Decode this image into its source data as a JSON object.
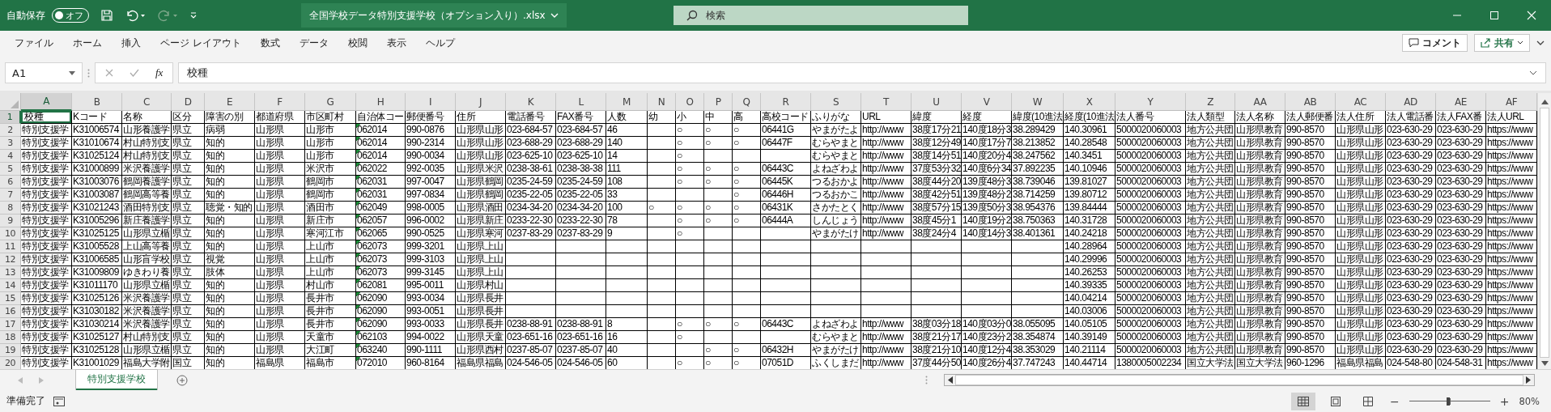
{
  "title_bar": {
    "autosave_label": "自動保存",
    "autosave": {
      "on": false,
      "label": "オフ"
    },
    "undo": {
      "disabled": false
    },
    "redo": {
      "disabled": true
    },
    "title": "全国学校データ特別支援学校（オプション入り）.xlsx",
    "search": {
      "placeholder": "検索"
    }
  },
  "ribbon_tabs": [
    "ファイル",
    "ホーム",
    "挿入",
    "ページ レイアウト",
    "数式",
    "データ",
    "校閲",
    "表示",
    "ヘルプ"
  ],
  "ribbon_buttons": {
    "comment": "コメント",
    "share": "共有"
  },
  "formula_bar": {
    "name_box": "A1",
    "fx": "fx",
    "value": "校種"
  },
  "columns": [
    {
      "label": "A",
      "selected": true
    },
    {
      "label": "B",
      "selected": false
    },
    {
      "label": "C",
      "selected": false
    },
    {
      "label": "D",
      "selected": false
    },
    {
      "label": "E",
      "selected": false
    },
    {
      "label": "F",
      "selected": false
    },
    {
      "label": "G",
      "selected": false
    },
    {
      "label": "H",
      "selected": false
    },
    {
      "label": "I",
      "selected": false
    },
    {
      "label": "J",
      "selected": false
    },
    {
      "label": "K",
      "selected": false
    },
    {
      "label": "L",
      "selected": false
    },
    {
      "label": "M",
      "selected": false
    },
    {
      "label": "N",
      "selected": false
    },
    {
      "label": "O",
      "selected": false
    },
    {
      "label": "P",
      "selected": false
    },
    {
      "label": "Q",
      "selected": false
    },
    {
      "label": "R",
      "selected": false
    },
    {
      "label": "S",
      "selected": false
    },
    {
      "label": "T",
      "selected": false
    },
    {
      "label": "U",
      "selected": false
    },
    {
      "label": "V",
      "selected": false
    },
    {
      "label": "W",
      "selected": false
    },
    {
      "label": "X",
      "selected": false
    },
    {
      "label": "Y",
      "selected": false
    },
    {
      "label": "Z",
      "selected": false
    },
    {
      "label": "AA",
      "selected": false
    },
    {
      "label": "AB",
      "selected": false
    },
    {
      "label": "AC",
      "selected": false
    },
    {
      "label": "AD",
      "selected": false
    },
    {
      "label": "AE",
      "selected": false
    },
    {
      "label": "AF",
      "selected": false
    }
  ],
  "rows": [
    {
      "number": "1",
      "selected": true,
      "cells": [
        "校種",
        "Kコード",
        "名称",
        "区分",
        "障害の別",
        "都道府県",
        "市区町村",
        "自治体コー",
        "郵便番号",
        "住所",
        "電話番号",
        "FAX番号",
        "人数",
        "幼",
        "小",
        "中",
        "高",
        "高校コード",
        "ふりがな",
        "URL",
        "緯度",
        "経度",
        "緯度(10進法",
        "経度(10進法",
        "法人番号",
        "法人類型",
        "法人名称",
        "法人郵便番",
        "法人住所",
        "法人電話番",
        "法人FAX番",
        "法人URL"
      ]
    },
    {
      "number": "2",
      "selected": false,
      "cells": [
        "特別支援学",
        "K31006574",
        "山形養護学",
        "県立",
        "病弱",
        "山形県",
        "山形市",
        "062014",
        "990-0876",
        "山形県山形",
        "023-684-57",
        "023-684-57",
        "46",
        null,
        "○",
        "○",
        "○",
        "06441G",
        "やまがたよ",
        "http://www",
        "38度17分21",
        "140度18分3",
        "38.289429",
        "140.30961",
        "5000020060003",
        "地方公共団",
        "山形県教育",
        "990-8570",
        "山形県山形",
        "023-630-29",
        "023-630-29",
        "https://www"
      ]
    },
    {
      "number": "3",
      "selected": false,
      "cells": [
        "特別支援学",
        "K31010674",
        "村山特別支",
        "県立",
        "知的",
        "山形県",
        "山形市",
        "062014",
        "990-2314",
        "山形県山形",
        "023-688-29",
        "023-688-29",
        "140",
        null,
        "○",
        "○",
        "○",
        "06447F",
        "むらやまと",
        "http://www",
        "38度12分49",
        "140度17分7",
        "38.213852",
        "140.28548",
        "5000020060003",
        "地方公共団",
        "山形県教育",
        "990-8570",
        "山形県山形",
        "023-630-29",
        "023-630-29",
        "https://www"
      ]
    },
    {
      "number": "4",
      "selected": false,
      "cells": [
        "特別支援学",
        "K31025124",
        "村山特別支",
        "県立",
        "知的",
        "山形県",
        "山形市",
        "062014",
        "990-0034",
        "山形県山形",
        "023-625-10",
        "023-625-10",
        "14",
        null,
        "○",
        null,
        null,
        null,
        "むらやまと",
        "http://www",
        "38度14分51",
        "140度20分4",
        "38.247562",
        "140.3451",
        "5000020060003",
        "地方公共団",
        "山形県教育",
        "990-8570",
        "山形県山形",
        "023-630-29",
        "023-630-29",
        "https://www"
      ]
    },
    {
      "number": "5",
      "selected": false,
      "cells": [
        "特別支援学",
        "K31000899",
        "米沢養護学",
        "県立",
        "知的",
        "山形県",
        "米沢市",
        "062022",
        "992-0035",
        "山形県米沢",
        "0238-38-61",
        "0238-38-38",
        "111",
        null,
        "○",
        "○",
        "○",
        "06443C",
        "よねざわよ",
        "http://www",
        "37度53分32",
        "140度6分34",
        "37.892235",
        "140.10946",
        "5000020060003",
        "地方公共団",
        "山形県教育",
        "990-8570",
        "山形県山形",
        "023-630-29",
        "023-630-29",
        "https://www"
      ]
    },
    {
      "number": "6",
      "selected": false,
      "cells": [
        "特別支援学",
        "K31003076",
        "鶴岡養護学",
        "県立",
        "知的",
        "山形県",
        "鶴岡市",
        "062031",
        "997-0047",
        "山形県鶴岡",
        "0235-24-59",
        "0235-24-59",
        "108",
        null,
        "○",
        "○",
        "○",
        "06445K",
        "つるおかよ",
        "http://www",
        "38度44分20",
        "139度48分3",
        "38.739046",
        "139.81027",
        "5000020060003",
        "地方公共団",
        "山形県教育",
        "990-8570",
        "山形県山形",
        "023-630-29",
        "023-630-29",
        "https://www"
      ]
    },
    {
      "number": "7",
      "selected": false,
      "cells": [
        "特別支援学",
        "K31003087",
        "鶴岡高等養",
        "県立",
        "知的",
        "山形県",
        "鶴岡市",
        "062031",
        "997-0834",
        "山形県鶴岡",
        "0235-22-05",
        "0235-22-05",
        "33",
        null,
        null,
        null,
        "○",
        "06446H",
        "つるおかこ",
        "http://www",
        "38度42分51",
        "139度48分2",
        "38.714259",
        "139.80712",
        "5000020060003",
        "地方公共団",
        "山形県教育",
        "990-8570",
        "山形県山形",
        "023-630-29",
        "023-630-29",
        "https://www"
      ]
    },
    {
      "number": "8",
      "selected": false,
      "cells": [
        "特別支援学",
        "K31021243",
        "酒田特別支",
        "県立",
        "聴覚・知的",
        "山形県",
        "酒田市",
        "062049",
        "998-0005",
        "山形県酒田",
        "0234-34-20",
        "0234-34-20",
        "100",
        "○",
        "○",
        "○",
        "○",
        "06431K",
        "さかたとく",
        "http://www",
        "38度57分15",
        "139度50分3",
        "38.954376",
        "139.84444",
        "5000020060003",
        "地方公共団",
        "山形県教育",
        "990-8570",
        "山形県山形",
        "023-630-29",
        "023-630-29",
        "https://www"
      ]
    },
    {
      "number": "9",
      "selected": false,
      "cells": [
        "特別支援学",
        "K31005296",
        "新庄養護学",
        "県立",
        "知的",
        "山形県",
        "新庄市",
        "062057",
        "996-0002",
        "山形県新庄",
        "0233-22-30",
        "0233-22-30",
        "78",
        null,
        "○",
        "○",
        "○",
        "06444A",
        "しんじょう",
        "http://www",
        "38度45分1",
        "140度19分2",
        "38.750363",
        "140.31728",
        "5000020060003",
        "地方公共団",
        "山形県教育",
        "990-8570",
        "山形県山形",
        "023-630-29",
        "023-630-29",
        "https://www"
      ]
    },
    {
      "number": "10",
      "selected": false,
      "cells": [
        "特別支援学",
        "K31025125",
        "山形県立楯",
        "県立",
        "知的",
        "山形県",
        "寒河江市",
        "062065",
        "990-0525",
        "山形県寒河",
        "0237-83-29",
        "0237-83-29",
        "9",
        null,
        "○",
        null,
        null,
        null,
        "やまがたけ",
        "http://www",
        "38度24分4",
        "140度14分3",
        "38.401361",
        "140.24218",
        "5000020060003",
        "地方公共団",
        "山形県教育",
        "990-8570",
        "山形県山形",
        "023-630-29",
        "023-630-29",
        "https://www"
      ]
    },
    {
      "number": "11",
      "selected": false,
      "cells": [
        "特別支援学",
        "K31005528",
        "上山高等養",
        "県立",
        "知的",
        "山形県",
        "上山市",
        "062073",
        "999-3201",
        "山形県上山",
        null,
        null,
        null,
        null,
        null,
        null,
        null,
        null,
        null,
        null,
        null,
        null,
        null,
        "140.28964",
        "5000020060003",
        "地方公共団",
        "山形県教育",
        "990-8570",
        "山形県山形",
        "023-630-29",
        "023-630-29",
        "https://www"
      ]
    },
    {
      "number": "12",
      "selected": false,
      "cells": [
        "特別支援学",
        "K31006585",
        "山形盲学校",
        "県立",
        "視覚",
        "山形県",
        "上山市",
        "062073",
        "999-3103",
        "山形県上山",
        null,
        null,
        null,
        null,
        null,
        null,
        null,
        null,
        null,
        null,
        null,
        null,
        null,
        "140.29996",
        "5000020060003",
        "地方公共団",
        "山形県教育",
        "990-8570",
        "山形県山形",
        "023-630-29",
        "023-630-29",
        "https://www"
      ]
    },
    {
      "number": "13",
      "selected": false,
      "cells": [
        "特別支援学",
        "K31009809",
        "ゆきわり養",
        "県立",
        "肢体",
        "山形県",
        "上山市",
        "062073",
        "999-3145",
        "山形県上山",
        null,
        null,
        null,
        null,
        null,
        null,
        null,
        null,
        null,
        null,
        null,
        null,
        null,
        "140.26253",
        "5000020060003",
        "地方公共団",
        "山形県教育",
        "990-8570",
        "山形県山形",
        "023-630-29",
        "023-630-29",
        "https://www"
      ]
    },
    {
      "number": "14",
      "selected": false,
      "cells": [
        "特別支援学",
        "K31011170",
        "山形県立楯",
        "県立",
        "知的",
        "山形県",
        "村山市",
        "062081",
        "995-0011",
        "山形県村山",
        null,
        null,
        null,
        null,
        null,
        null,
        null,
        null,
        null,
        null,
        null,
        null,
        null,
        "140.39335",
        "5000020060003",
        "地方公共団",
        "山形県教育",
        "990-8570",
        "山形県山形",
        "023-630-29",
        "023-630-29",
        "https://www"
      ]
    },
    {
      "number": "15",
      "selected": false,
      "cells": [
        "特別支援学",
        "K31025126",
        "米沢養護学",
        "県立",
        "知的",
        "山形県",
        "長井市",
        "062090",
        "993-0034",
        "山形県長井",
        null,
        null,
        null,
        null,
        null,
        null,
        null,
        null,
        null,
        null,
        null,
        null,
        null,
        "140.04214",
        "5000020060003",
        "地方公共団",
        "山形県教育",
        "990-8570",
        "山形県山形",
        "023-630-29",
        "023-630-29",
        "https://www"
      ]
    },
    {
      "number": "16",
      "selected": false,
      "cells": [
        "特別支援学",
        "K31030182",
        "米沢養護学",
        "県立",
        "知的",
        "山形県",
        "長井市",
        "062090",
        "993-0051",
        "山形県長井",
        null,
        null,
        null,
        null,
        null,
        null,
        null,
        null,
        null,
        null,
        null,
        null,
        null,
        "140.03006",
        "5000020060003",
        "地方公共団",
        "山形県教育",
        "990-8570",
        "山形県山形",
        "023-630-29",
        "023-630-29",
        "https://www"
      ]
    },
    {
      "number": "17",
      "selected": false,
      "cells": [
        "特別支援学",
        "K31030214",
        "米沢養護学",
        "県立",
        "知的",
        "山形県",
        "長井市",
        "062090",
        "993-0033",
        "山形県長井",
        "0238-88-91",
        "0238-88-91",
        "8",
        null,
        "○",
        "○",
        "○",
        "06443C",
        "よねざわよ",
        "http://www",
        "38度03分18",
        "140度03分0",
        "38.055095",
        "140.05105",
        "5000020060003",
        "地方公共団",
        "山形県教育",
        "990-8570",
        "山形県山形",
        "023-630-29",
        "023-630-29",
        "https://www"
      ]
    },
    {
      "number": "18",
      "selected": false,
      "cells": [
        "特別支援学",
        "K31025127",
        "村山特別支",
        "県立",
        "知的",
        "山形県",
        "天童市",
        "062103",
        "994-0022",
        "山形県天童",
        "023-651-16",
        "023-651-16",
        "16",
        null,
        "○",
        null,
        null,
        null,
        "むらやまと",
        "http://www",
        "38度21分17",
        "140度23分2",
        "38.354874",
        "140.39149",
        "5000020060003",
        "地方公共団",
        "山形県教育",
        "990-8570",
        "山形県山形",
        "023-630-29",
        "023-630-29",
        "https://www"
      ]
    },
    {
      "number": "19",
      "selected": false,
      "cells": [
        "特別支援学",
        "K31025128",
        "山形県立楯",
        "県立",
        "知的",
        "山形県",
        "大江町",
        "063240",
        "990-1111",
        "山形県西村",
        "0237-85-07",
        "0237-85-07",
        "40",
        null,
        null,
        "○",
        "○",
        "06432H",
        "やまがたけ",
        "http://www",
        "38度21分10",
        "140度12分4",
        "38.353029",
        "140.21114",
        "5000020060003",
        "地方公共団",
        "山形県教育",
        "990-8570",
        "山形県山形",
        "023-630-29",
        "023-630-29",
        "https://www"
      ]
    },
    {
      "number": "20",
      "selected": false,
      "cells": [
        "特別支援学",
        "K31001029",
        "福島大学附",
        "国立",
        "知的",
        "福島県",
        "福島市",
        "072010",
        "960-8164",
        "福島県福島",
        "024-546-05",
        "024-546-05",
        "60",
        null,
        "○",
        "○",
        "○",
        "07051D",
        "ふくしまだ",
        "http://www",
        "37度44分50",
        "140度26分4",
        "37.747243",
        "140.44714",
        "1380005002234",
        "国立大学法",
        "国立大学法",
        "960-1296",
        "福島県福島",
        "024-548-80",
        "024-548-31",
        "https://www"
      ]
    }
  ],
  "sheet_tabs": [
    {
      "label": "特別支援学校",
      "selected": true
    }
  ],
  "status_bar": {
    "status": "準備完了",
    "views": [
      {
        "kind": "normal",
        "selected": true
      },
      {
        "kind": "page_layout",
        "selected": false
      },
      {
        "kind": "page_break",
        "selected": false
      }
    ],
    "zoom": {
      "out": "−",
      "in": "+",
      "level": 0.48,
      "reading": "80%"
    }
  }
}
